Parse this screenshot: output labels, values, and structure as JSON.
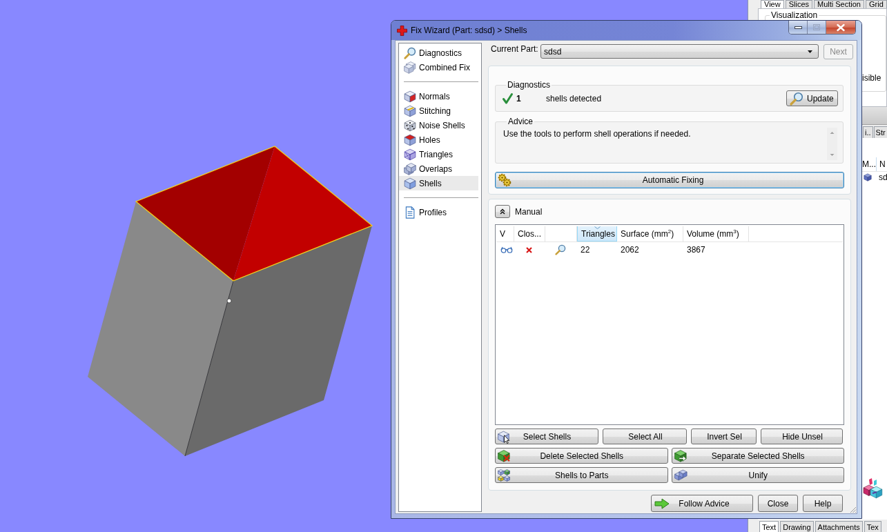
{
  "background_app": {
    "top_tabs": [
      {
        "label": "View",
        "selected": true
      },
      {
        "label": "Slices",
        "selected": false
      },
      {
        "label": "Multi Section",
        "selected": false
      },
      {
        "label": "Grid",
        "selected": false
      }
    ],
    "group_title": "Visualization",
    "option_label": "isible",
    "tabs": [
      {
        "label": "i..",
        "selected": false
      },
      {
        "label": "Str",
        "selected": false
      }
    ],
    "list": {
      "columns": [
        "M...",
        "N"
      ],
      "rows": [
        {
          "name": "sd"
        }
      ]
    },
    "bottom_tabs": [
      {
        "label": "Text",
        "selected": true
      },
      {
        "label": "Drawing",
        "selected": false
      },
      {
        "label": "Attachments",
        "selected": false
      },
      {
        "label": "Tex",
        "selected": false
      }
    ]
  },
  "window": {
    "title": "Fix Wizard (Part: sdsd) > Shells"
  },
  "sidebar": {
    "groups": [
      {
        "items": [
          {
            "label": "Diagnostics",
            "selected": false
          },
          {
            "label": "Combined Fix",
            "selected": false
          }
        ]
      },
      {
        "items": [
          {
            "label": "Normals",
            "selected": false
          },
          {
            "label": "Stitching",
            "selected": false
          },
          {
            "label": "Noise Shells",
            "selected": false
          },
          {
            "label": "Holes",
            "selected": false
          },
          {
            "label": "Triangles",
            "selected": false
          },
          {
            "label": "Overlaps",
            "selected": false
          },
          {
            "label": "Shells",
            "selected": true
          }
        ]
      },
      {
        "items": [
          {
            "label": "Profiles",
            "selected": false
          }
        ]
      }
    ]
  },
  "current_part": {
    "label": "Current Part:",
    "value": "sdsd"
  },
  "next_button": {
    "label": "Next",
    "disabled": true
  },
  "diagnostics": {
    "title": "Diagnostics",
    "passed": true,
    "count": "1",
    "text": "shells detected",
    "update_button": "Update"
  },
  "advice": {
    "title": "Advice",
    "text": "Use the tools to perform shell operations if needed."
  },
  "automatic_fixing_button": {
    "label": "Automatic Fixing",
    "focused": true
  },
  "manual": {
    "label": "Manual",
    "expanded": true,
    "table": {
      "columns": [
        {
          "label": "V",
          "sorted": false
        },
        {
          "label": "Clos...",
          "sorted": false
        },
        {
          "sorted": false
        },
        {
          "label": "Triangles",
          "sorted": true
        },
        {
          "label": "Surface (mm$^{2}$)",
          "sorted": false
        },
        {
          "label": "Volume (mm$^{3}$)",
          "sorted": false
        }
      ],
      "rows": [
        {
          "visible": true,
          "closed": false,
          "triangles": "22",
          "surface": "2062",
          "volume": "3867"
        }
      ]
    },
    "tool_buttons": [
      [
        {
          "label": "Select Shells"
        },
        {
          "label": "Select All"
        },
        {
          "label": "Invert Sel"
        },
        {
          "label": "Hide Unsel"
        }
      ],
      [
        {
          "label": "Delete Selected Shells"
        },
        {
          "label": "Separate Selected Shells"
        }
      ],
      [
        {
          "label": "Shells to Parts"
        },
        {
          "label": "Unify"
        }
      ]
    ]
  },
  "footer_buttons": [
    {
      "label": "Follow Advice"
    },
    {
      "label": "Close"
    },
    {
      "label": "Help"
    }
  ]
}
